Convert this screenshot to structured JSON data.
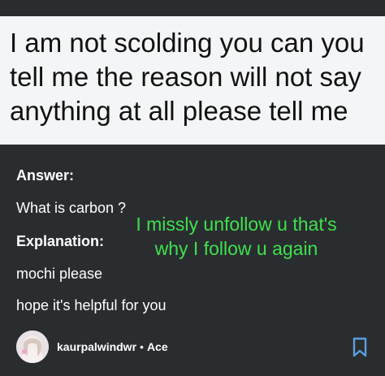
{
  "question": {
    "text": "I am not scolding you can you tell me the reason will not say anything at all please tell me"
  },
  "answer": {
    "heading": "Answer:",
    "line": "What is carbon ?",
    "explanation_heading": "Explanation:",
    "explanation_lines": [
      "mochi please",
      "hope it's helpful for you"
    ]
  },
  "overlay": {
    "lines": [
      "I missly unfollow u that's",
      "why I follow u again"
    ],
    "color": "#3ee04c"
  },
  "author": {
    "username": "kaurpalwindwr",
    "separator": "•",
    "rank": "Ace"
  },
  "icons": {
    "avatar": "avatar-image",
    "bookmark": "bookmark-icon"
  },
  "colors": {
    "question_bg": "#f4f5f6",
    "answer_bg": "#2a2d30",
    "text_light": "#ffffff"
  }
}
